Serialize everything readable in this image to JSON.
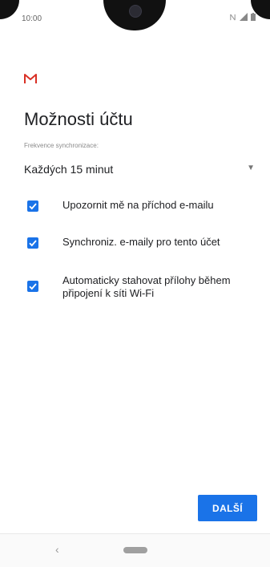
{
  "status_bar": {
    "time": "10:00"
  },
  "page": {
    "title": "Možnosti účtu",
    "field_label": "Frekvence synchronizace:",
    "sync_frequency": "Každých 15 minut"
  },
  "options": [
    {
      "label": "Upozornit mě na příchod e-mailu",
      "checked": true
    },
    {
      "label": "Synchroniz. e-maily pro tento účet",
      "checked": true
    },
    {
      "label": "Automaticky stahovat přílohy během připojení k síti Wi-Fi",
      "checked": true
    }
  ],
  "footer": {
    "next_label": "DALŠÍ"
  },
  "icons": {
    "gmail": "gmail-logo-icon",
    "dropdown": "chevron-down-icon",
    "back": "back-icon",
    "home": "home-icon"
  },
  "colors": {
    "accent": "#1a73e8",
    "gmail_red": "#d93025"
  }
}
